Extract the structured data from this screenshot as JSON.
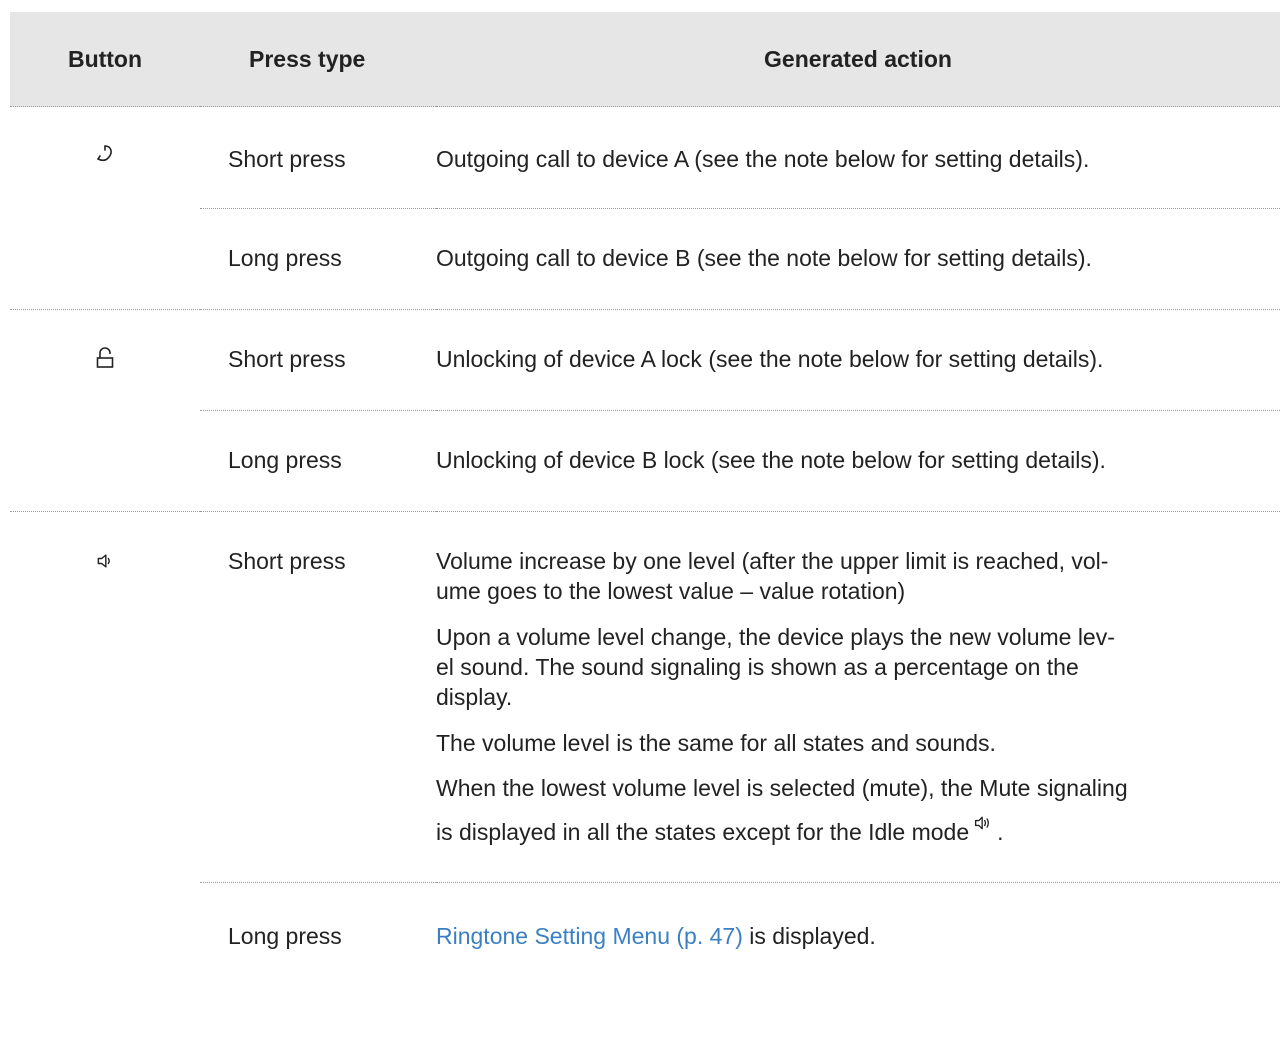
{
  "table": {
    "headers": {
      "button": "Button",
      "press_type": "Press type",
      "action": "Generated action"
    },
    "groups": [
      {
        "icon": "handset-icon",
        "rows": [
          {
            "press": "Short press",
            "paragraphs": [
              "Outgoing call to device A (see the note below for setting details)."
            ]
          },
          {
            "press": "Long press",
            "paragraphs": [
              "Outgoing call to device B (see the note below for setting details)."
            ]
          }
        ]
      },
      {
        "icon": "unlock-icon",
        "rows": [
          {
            "press": "Short press",
            "paragraphs": [
              "Unlocking of device A lock (see the note below for setting details)."
            ]
          },
          {
            "press": "Long press",
            "paragraphs": [
              "Unlocking of device B lock (see the note below for setting details)."
            ]
          }
        ]
      },
      {
        "icon": "speaker-icon",
        "rows": [
          {
            "press": "Short press",
            "paragraphs": [
              "Volume increase by one level (after the upper limit is reached, vol-",
              "ume goes to the lowest value – value rotation)",
              "Upon a volume level change, the device plays the new volume lev-",
              "el sound. The sound signaling is shown as a percentage on the",
              "display.",
              "The volume level is the same for all states and sounds.",
              "When the lowest volume level is selected (mute), the Mute signaling",
              "is displayed in all the states except for the Idle mode",
              "."
            ]
          },
          {
            "press": "Long press",
            "link": "Ringtone Setting Menu (p. 47)",
            "link_suffix": " is displayed."
          }
        ]
      }
    ]
  },
  "colors": {
    "header_bg": "#e6e6e6",
    "link": "#3b7fc4",
    "divider": "#9a9a9a"
  }
}
